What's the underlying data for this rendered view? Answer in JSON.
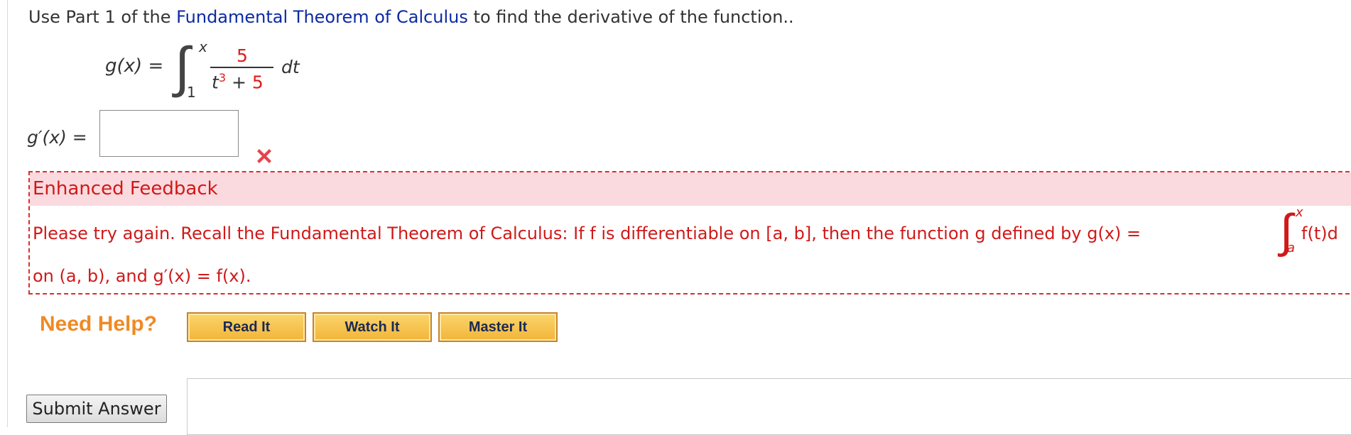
{
  "intro": {
    "before": "Use Part 1 of the ",
    "link": "Fundamental Theorem of Calculus",
    "after": " to find the derivative of the function.."
  },
  "integral": {
    "label": "g(x) =",
    "upper": "x",
    "lower": "1",
    "numerator": "5",
    "den_base": "t",
    "den_exp": "3",
    "den_plus": " + ",
    "den_const": "5",
    "differential": "dt"
  },
  "answer": {
    "label": "g′(x) =",
    "value": "",
    "status_icon": "x-mark-icon",
    "status_color": "#e8424a"
  },
  "feedback": {
    "header": "Enhanced Feedback",
    "line1": "Please try again. Recall the Fundamental Theorem of Calculus: If f is differentiable on  [a, b],  then the function g defined by  g(x) = ",
    "int_upper": "x",
    "int_lower": "a",
    "line1_tail": "f(t)d",
    "line2": "on  (a, b),  and  g′(x) = f(x).",
    "color": "#d01919",
    "header_bg": "#fadadf"
  },
  "help": {
    "label": "Need Help?",
    "buttons": [
      "Read It",
      "Watch It",
      "Master It"
    ]
  },
  "submit": {
    "label": "Submit Answer"
  }
}
